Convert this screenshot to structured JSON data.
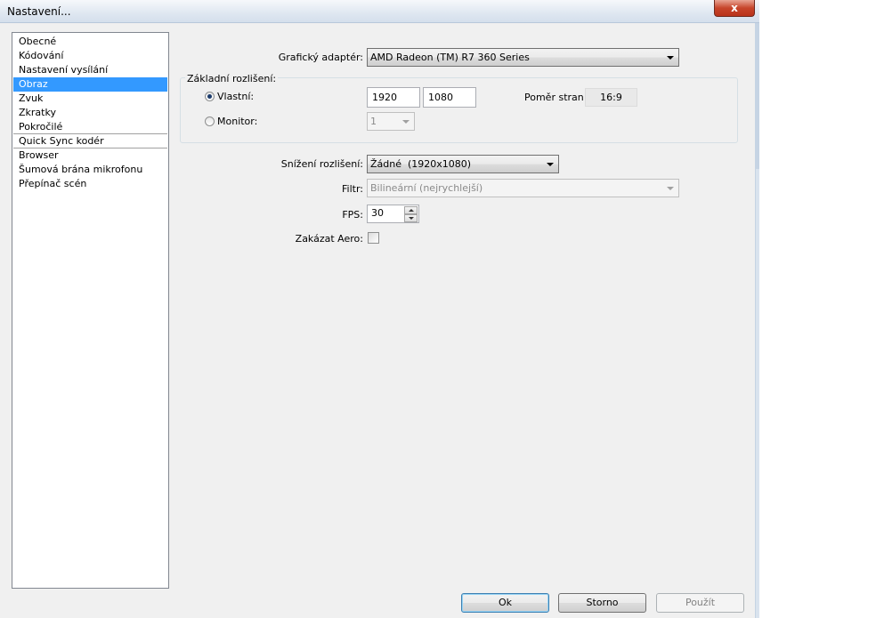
{
  "window": {
    "title": "Nastavení...",
    "close_label": "x"
  },
  "sidebar": {
    "items": [
      {
        "label": "Obecné"
      },
      {
        "label": "Kódování"
      },
      {
        "label": "Nastavení vysílání"
      },
      {
        "label": "Obraz",
        "selected": true
      },
      {
        "label": "Zvuk"
      },
      {
        "label": "Zkratky"
      },
      {
        "label": "Pokročilé"
      },
      {
        "label": "Quick Sync kodér"
      },
      {
        "label": "Browser"
      },
      {
        "label": "Šumová brána mikrofonu"
      },
      {
        "label": "Přepínač scén"
      }
    ]
  },
  "video": {
    "adapter_label": "Grafický adaptér:",
    "adapter_value": "AMD Radeon (TM) R7 360 Series",
    "base_res_title": "Základní rozlišení:",
    "custom_label": "Vlastní:",
    "custom_selected": true,
    "width": "1920",
    "height": "1080",
    "aspect_label": "Poměr stran:",
    "aspect_value": "16:9",
    "monitor_label": "Monitor:",
    "monitor_value": "1",
    "downscale_label": "Snížení rozlišení:",
    "downscale_value": "Žádné  (1920x1080)",
    "filter_label": "Filtr:",
    "filter_value": "Bilineární (nejrychlejší)",
    "fps_label": "FPS:",
    "fps_value": "30",
    "aero_label": "Zakázat Aero:",
    "aero_checked": false
  },
  "buttons": {
    "ok": "Ok",
    "cancel": "Storno",
    "apply": "Použít"
  },
  "colors": {
    "selection": "#3399ff",
    "window_bg": "#f0f0f0"
  }
}
